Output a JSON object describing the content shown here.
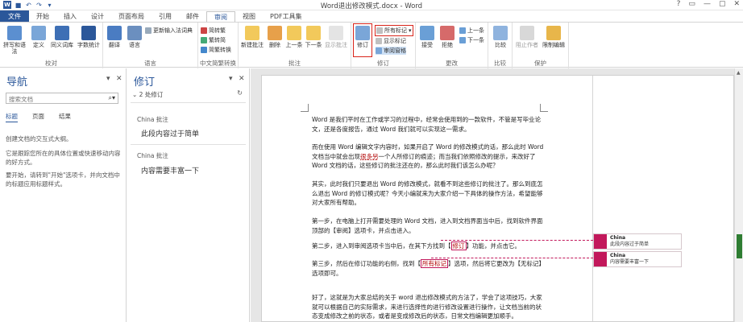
{
  "window": {
    "title": "Word退出修改模式.docx - Word",
    "logo": "W",
    "controls": [
      "?",
      "▭",
      "—",
      "▢",
      "✕"
    ]
  },
  "tabs": [
    "文件",
    "开始",
    "插入",
    "设计",
    "页面布局",
    "引用",
    "邮件",
    "审阅",
    "视图",
    "PDF工具集"
  ],
  "ribbon": {
    "proofing": {
      "label": "校对",
      "spell": "拼写和语法",
      "define": "定义",
      "thesaurus": "同义词库",
      "wordcount": "字数统计"
    },
    "language": {
      "label": "语言",
      "translate": "翻译",
      "language": "语言",
      "new_ime": "更新输入法词典"
    },
    "chinese": {
      "label": "中文简繁转换",
      "to_trad": "简转繁",
      "to_simp": "繁转简",
      "convert": "简繁转换"
    },
    "comments": {
      "label": "批注",
      "new": "新建批注",
      "delete": "删除",
      "prev": "上一条",
      "next": "下一条",
      "show": "显示批注"
    },
    "tracking": {
      "label": "修订",
      "track": "修订",
      "markup_select": "所有标记",
      "show_markup": "显示标记",
      "pane": "审阅窗格"
    },
    "changes": {
      "label": "更改",
      "accept": "接受",
      "reject": "拒绝",
      "prev": "上一条",
      "next": "下一条"
    },
    "compare": {
      "label": "比较",
      "compare": "比较"
    },
    "protect": {
      "label": "保护",
      "block": "阻止作者",
      "restrict": "限制编辑"
    }
  },
  "nav": {
    "title": "导航",
    "search_placeholder": "搜索文档",
    "tabs": [
      "标题",
      "页面",
      "结果"
    ],
    "help1": "创建文档的交互式大纲。",
    "help2": "它是跟踪您所在的具体位置或快速移动内容的好方式。",
    "help3": "要开始，请转到\"开始\"选项卡，并向文档中的标题应用标题样式。"
  },
  "revisions": {
    "title": "修订",
    "count": "2 处修订",
    "items": [
      {
        "author": "China 批注",
        "text": "此段内容过于简单"
      },
      {
        "author": "China 批注",
        "text": "内容需要丰富一下"
      }
    ]
  },
  "doc": {
    "p1": "Word 是我们平时在工作或学习的过程中，经常会使用到的一款软件，不管是写毕业论文，还是各度报告，通过 Word 我们就可以实现这一需求。",
    "p2a": "而在使用 Word 编辑文字内容时，如果开启了 Word 的修改模式的话，那么此时 Word 文档当中就会出现",
    "p2u": "很多另",
    "p2b": "一个人所修订的痕迹；而当我们依照修改的提示，来改好了 Word 文档的话，这些修订的批注还在的，那么此时我们该怎么办呢？",
    "p3": "其实，此时我们只要退出 Word 的修改模式，就看不到这些修订的批注了。那么到底怎么退出 Word 的修订模式呢？今天小编就来为大家介绍一下具体的操作方法，希望能够对大家所有帮助。",
    "p4": "第一步，在电脑上打开需要处理的 Word 文档，进入到文档界面当中后，找到软件界面顶部的【审阅】选项卡，并点击进入。",
    "p5a": "第二步，进入到审阅选项卡当中后，在其下方找到【",
    "p5m": "修订",
    "p5b": "】功能，并点击它。",
    "p6a": "第三步，然后在修订功能的右侧，找到【",
    "p6m": "所有标记",
    "p6b": "】选项，然后将它更改为【无标记】选项即可。",
    "p7": "好了，这就是为大家总结的关于 word 退出修改模式的方法了，学会了这项技巧，大家就可以根据自己的实际需求，来进行选择性的进行修改设置进行操作，让文档当前的状态变成修改之前的状态，或者是变成修改后的状态，日常文档编辑更加顺手。"
  },
  "balloons": [
    {
      "author": "China",
      "text": "此段内容过于简单"
    },
    {
      "author": "China",
      "text": "内容需要丰富一下"
    }
  ]
}
